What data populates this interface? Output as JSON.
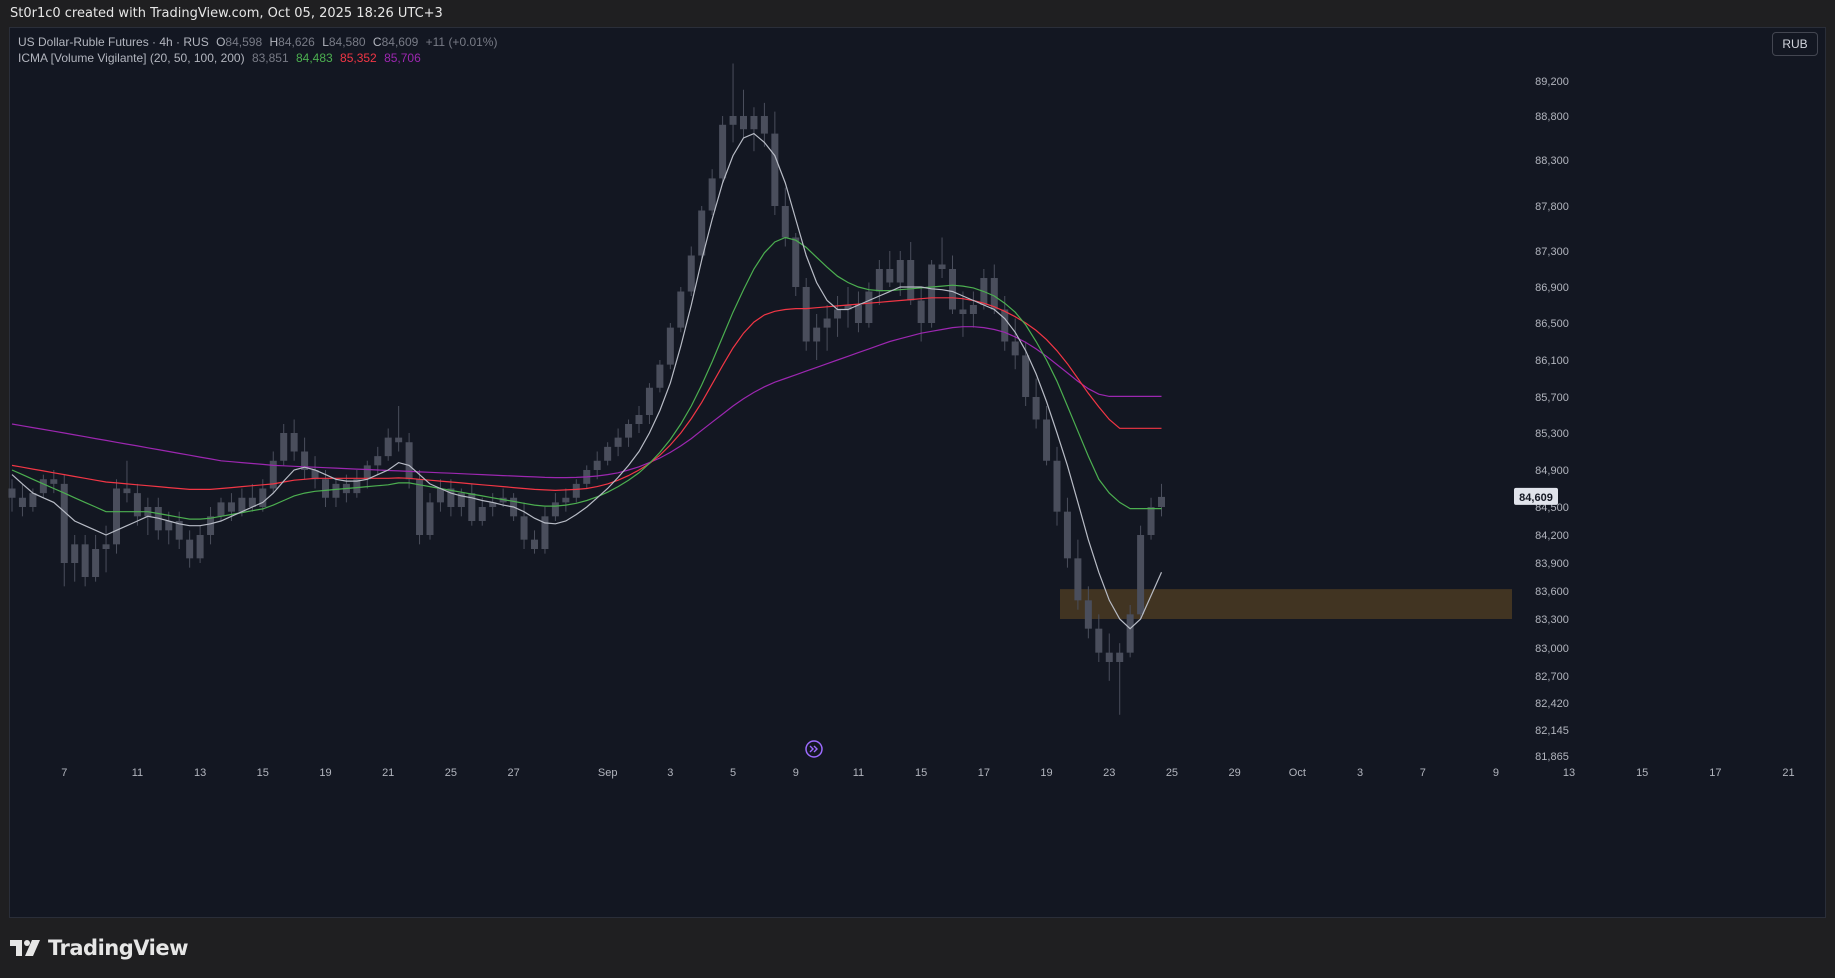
{
  "header": {
    "attribution": "St0r1c0 created with TradingView.com, Oct 05, 2025 18:26 UTC+3"
  },
  "legend": {
    "symbol_line": "US Dollar-Ruble Futures · 4h · RUS",
    "open_label": "O",
    "open": "84,598",
    "high_label": "H",
    "high": "84,626",
    "low_label": "L",
    "low": "84,580",
    "close_label": "C",
    "close": "84,609",
    "change": "+11 (+0.01%)",
    "indicator_name": "ICMA [Volume Vigilante] (20, 50, 100, 200)",
    "ma_values": [
      "83,851",
      "84,483",
      "85,352",
      "85,706"
    ]
  },
  "currency_button": "RUB",
  "footer": {
    "brand": "TradingView"
  },
  "colors": {
    "background": "#131722",
    "ma20": "#b8bcc6",
    "ma50": "#4caf50",
    "ma100": "#f23645",
    "ma200": "#9c27b0",
    "candle": "#4a4e5c",
    "zone": "#4a3a22",
    "price_tag": "#e0e3eb"
  },
  "chart_data": {
    "type": "candlestick",
    "interval": "4h",
    "y_ticks": [
      "89,200",
      "88,800",
      "88,300",
      "87,800",
      "87,300",
      "86,900",
      "86,500",
      "86,100",
      "85,700",
      "85,300",
      "84,900",
      "84,500",
      "84,200",
      "83,900",
      "83,600",
      "83,300",
      "83,000",
      "82,700",
      "82,420",
      "82,145",
      "81,865"
    ],
    "y_tick_values": [
      89200,
      88800,
      88300,
      87800,
      87300,
      86900,
      86500,
      86100,
      85700,
      85300,
      84900,
      84500,
      84200,
      83900,
      83600,
      83300,
      83000,
      82700,
      82420,
      82145,
      81865
    ],
    "x_ticks": [
      "7",
      "11",
      "13",
      "15",
      "19",
      "21",
      "25",
      "27",
      "Sep",
      "3",
      "5",
      "9",
      "11",
      "15",
      "17",
      "19",
      "23",
      "25",
      "29",
      "Oct",
      "3",
      "7",
      "9",
      "13",
      "15",
      "17",
      "21"
    ],
    "x_tick_index": [
      5,
      12,
      18,
      24,
      30,
      36,
      42,
      48,
      57,
      63,
      69,
      75,
      81,
      87,
      93,
      99,
      105,
      111,
      117,
      123,
      129,
      135,
      142,
      149,
      156,
      163,
      170
    ],
    "last_price": "84,609",
    "last_price_value": 84609,
    "demand_zone": {
      "low": 83300,
      "high": 83620
    },
    "ma_names": [
      "20",
      "50",
      "100",
      "200"
    ],
    "candles": [
      [
        84700,
        84800,
        84450,
        84600
      ],
      [
        84600,
        84750,
        84400,
        84500
      ],
      [
        84500,
        84700,
        84450,
        84650
      ],
      [
        84650,
        84850,
        84600,
        84800
      ],
      [
        84800,
        84900,
        84650,
        84750
      ],
      [
        84750,
        84850,
        83650,
        83900
      ],
      [
        83900,
        84200,
        83700,
        84100
      ],
      [
        84100,
        84200,
        83650,
        83750
      ],
      [
        83750,
        84200,
        83700,
        84050
      ],
      [
        84050,
        84300,
        83800,
        84100
      ],
      [
        84100,
        84800,
        84000,
        84700
      ],
      [
        84700,
        85000,
        84550,
        84650
      ],
      [
        84650,
        84750,
        84300,
        84400
      ],
      [
        84400,
        84600,
        84200,
        84500
      ],
      [
        84500,
        84600,
        84150,
        84250
      ],
      [
        84250,
        84450,
        84100,
        84350
      ],
      [
        84350,
        84450,
        84050,
        84150
      ],
      [
        84150,
        84250,
        83850,
        83950
      ],
      [
        83950,
        84300,
        83900,
        84200
      ],
      [
        84200,
        84500,
        84100,
        84400
      ],
      [
        84400,
        84600,
        84350,
        84550
      ],
      [
        84550,
        84650,
        84350,
        84450
      ],
      [
        84450,
        84700,
        84400,
        84600
      ],
      [
        84600,
        84750,
        84450,
        84500
      ],
      [
        84500,
        84800,
        84450,
        84700
      ],
      [
        84700,
        85100,
        84650,
        85000
      ],
      [
        85000,
        85400,
        84950,
        85300
      ],
      [
        85300,
        85450,
        85000,
        85100
      ],
      [
        85100,
        85250,
        84800,
        84900
      ],
      [
        84900,
        85050,
        84700,
        84800
      ],
      [
        84800,
        84900,
        84500,
        84600
      ],
      [
        84600,
        84800,
        84500,
        84750
      ],
      [
        84750,
        84850,
        84550,
        84650
      ],
      [
        84650,
        84900,
        84600,
        84800
      ],
      [
        84800,
        85000,
        84700,
        84950
      ],
      [
        84950,
        85150,
        84850,
        85050
      ],
      [
        85050,
        85350,
        85000,
        85250
      ],
      [
        85250,
        85600,
        85100,
        85200
      ],
      [
        85200,
        85300,
        84700,
        84800
      ],
      [
        84800,
        84900,
        84100,
        84200
      ],
      [
        84200,
        84650,
        84150,
        84550
      ],
      [
        84550,
        84800,
        84450,
        84700
      ],
      [
        84700,
        84800,
        84400,
        84500
      ],
      [
        84500,
        84700,
        84400,
        84650
      ],
      [
        84650,
        84750,
        84300,
        84350
      ],
      [
        84350,
        84600,
        84300,
        84500
      ],
      [
        84500,
        84650,
        84400,
        84550
      ],
      [
        84550,
        84700,
        84500,
        84600
      ],
      [
        84600,
        84650,
        84350,
        84400
      ],
      [
        84400,
        84550,
        84050,
        84150
      ],
      [
        84150,
        84250,
        84000,
        84050
      ],
      [
        84050,
        84500,
        84000,
        84400
      ],
      [
        84400,
        84650,
        84350,
        84550
      ],
      [
        84550,
        84700,
        84450,
        84600
      ],
      [
        84600,
        84800,
        84550,
        84750
      ],
      [
        84750,
        84950,
        84700,
        84900
      ],
      [
        84900,
        85100,
        84800,
        85000
      ],
      [
        85000,
        85200,
        84950,
        85150
      ],
      [
        85150,
        85350,
        85050,
        85250
      ],
      [
        85250,
        85450,
        85150,
        85400
      ],
      [
        85400,
        85600,
        85300,
        85500
      ],
      [
        85500,
        85850,
        85400,
        85800
      ],
      [
        85800,
        86100,
        85750,
        86050
      ],
      [
        86050,
        86500,
        86000,
        86450
      ],
      [
        86450,
        86900,
        86400,
        86850
      ],
      [
        86850,
        87350,
        86800,
        87250
      ],
      [
        87250,
        87800,
        87200,
        87750
      ],
      [
        87750,
        88200,
        87700,
        88100
      ],
      [
        88100,
        88800,
        88050,
        88700
      ],
      [
        88700,
        89400,
        88500,
        88800
      ],
      [
        88800,
        89100,
        88550,
        88650
      ],
      [
        88650,
        88900,
        88400,
        88800
      ],
      [
        88800,
        88950,
        88450,
        88600
      ],
      [
        88600,
        88850,
        87700,
        87800
      ],
      [
        87800,
        88000,
        87350,
        87450
      ],
      [
        87450,
        87500,
        86800,
        86900
      ],
      [
        86900,
        87000,
        86200,
        86300
      ],
      [
        86300,
        86600,
        86100,
        86450
      ],
      [
        86450,
        86700,
        86200,
        86550
      ],
      [
        86550,
        86800,
        86350,
        86650
      ],
      [
        86650,
        86900,
        86450,
        86700
      ],
      [
        86700,
        86850,
        86400,
        86500
      ],
      [
        86500,
        86950,
        86450,
        86850
      ],
      [
        86850,
        87200,
        86700,
        87100
      ],
      [
        87100,
        87300,
        86900,
        86950
      ],
      [
        86950,
        87300,
        86800,
        87200
      ],
      [
        87200,
        87400,
        86700,
        86750
      ],
      [
        86750,
        86900,
        86300,
        86500
      ],
      [
        86500,
        87200,
        86450,
        87150
      ],
      [
        87150,
        87450,
        87000,
        87100
      ],
      [
        87100,
        87250,
        86600,
        86650
      ],
      [
        86650,
        86850,
        86350,
        86600
      ],
      [
        86600,
        86850,
        86450,
        86700
      ],
      [
        86700,
        87100,
        86650,
        87000
      ],
      [
        87000,
        87150,
        86600,
        86650
      ],
      [
        86650,
        86800,
        86200,
        86300
      ],
      [
        86300,
        86550,
        86000,
        86150
      ],
      [
        86150,
        86300,
        85600,
        85700
      ],
      [
        85700,
        85900,
        85350,
        85450
      ],
      [
        85450,
        85600,
        84950,
        85000
      ],
      [
        85000,
        85150,
        84300,
        84450
      ],
      [
        84450,
        84600,
        83850,
        83950
      ],
      [
        83950,
        84150,
        83400,
        83500
      ],
      [
        83500,
        83650,
        83100,
        83200
      ],
      [
        83200,
        83350,
        82850,
        82950
      ],
      [
        82950,
        83150,
        82650,
        82850
      ],
      [
        82850,
        83050,
        82300,
        82950
      ],
      [
        82950,
        83450,
        82900,
        83350
      ],
      [
        83350,
        84300,
        83300,
        84200
      ],
      [
        84200,
        84600,
        84150,
        84500
      ],
      [
        84500,
        84750,
        84400,
        84609
      ]
    ],
    "ma": {
      "ma20": [
        84850,
        84750,
        84650,
        84600,
        84550,
        84450,
        84350,
        84300,
        84250,
        84200,
        84250,
        84300,
        84350,
        84400,
        84380,
        84350,
        84320,
        84300,
        84300,
        84320,
        84350,
        84400,
        84450,
        84500,
        84550,
        84650,
        84780,
        84900,
        84930,
        84900,
        84850,
        84800,
        84780,
        84780,
        84800,
        84850,
        84900,
        84980,
        84950,
        84850,
        84750,
        84700,
        84650,
        84620,
        84600,
        84570,
        84550,
        84520,
        84500,
        84450,
        84380,
        84330,
        84320,
        84350,
        84420,
        84500,
        84600,
        84700,
        84820,
        84950,
        85100,
        85300,
        85550,
        85850,
        86250,
        86700,
        87200,
        87650,
        88050,
        88350,
        88550,
        88600,
        88500,
        88350,
        88050,
        87650,
        87250,
        86950,
        86750,
        86650,
        86650,
        86700,
        86750,
        86800,
        86850,
        86900,
        86900,
        86900,
        86880,
        86870,
        86850,
        86800,
        86750,
        86700,
        86650,
        86550,
        86400,
        86200,
        85950,
        85650,
        85300,
        84950,
        84550,
        84150,
        83800,
        83500,
        83300,
        83200,
        83300,
        83550,
        83800
      ],
      "ma50": [
        84900,
        84850,
        84800,
        84750,
        84700,
        84650,
        84600,
        84550,
        84500,
        84450,
        84450,
        84450,
        84450,
        84450,
        84430,
        84410,
        84390,
        84370,
        84370,
        84380,
        84400,
        84420,
        84440,
        84460,
        84480,
        84520,
        84570,
        84620,
        84650,
        84670,
        84680,
        84690,
        84700,
        84710,
        84720,
        84730,
        84740,
        84760,
        84760,
        84740,
        84720,
        84700,
        84680,
        84660,
        84640,
        84620,
        84600,
        84580,
        84560,
        84540,
        84520,
        84510,
        84510,
        84520,
        84540,
        84570,
        84610,
        84660,
        84720,
        84790,
        84870,
        84970,
        85090,
        85230,
        85400,
        85600,
        85830,
        86080,
        86350,
        86620,
        86870,
        87100,
        87280,
        87400,
        87450,
        87420,
        87340,
        87230,
        87120,
        87020,
        86950,
        86900,
        86870,
        86860,
        86860,
        86870,
        86880,
        86890,
        86900,
        86910,
        86920,
        86910,
        86890,
        86850,
        86800,
        86720,
        86620,
        86480,
        86300,
        86100,
        85870,
        85600,
        85320,
        85050,
        84800,
        84650,
        84550,
        84483,
        84483,
        84483,
        84483
      ],
      "ma100": [
        84950,
        84930,
        84910,
        84890,
        84870,
        84850,
        84830,
        84810,
        84790,
        84770,
        84760,
        84750,
        84740,
        84730,
        84720,
        84710,
        84700,
        84690,
        84690,
        84690,
        84700,
        84710,
        84720,
        84730,
        84740,
        84750,
        84770,
        84790,
        84800,
        84810,
        84810,
        84810,
        84810,
        84810,
        84810,
        84810,
        84810,
        84815,
        84810,
        84800,
        84790,
        84780,
        84770,
        84760,
        84750,
        84740,
        84730,
        84720,
        84710,
        84700,
        84690,
        84685,
        84680,
        84685,
        84690,
        84700,
        84720,
        84750,
        84790,
        84840,
        84900,
        84970,
        85060,
        85170,
        85300,
        85460,
        85640,
        85840,
        86040,
        86230,
        86390,
        86510,
        86590,
        86630,
        86650,
        86660,
        86660,
        86670,
        86680,
        86690,
        86700,
        86710,
        86720,
        86730,
        86740,
        86750,
        86760,
        86770,
        86780,
        86780,
        86780,
        86770,
        86750,
        86720,
        86680,
        86630,
        86570,
        86500,
        86420,
        86320,
        86200,
        86060,
        85900,
        85740,
        85590,
        85450,
        85352,
        85352,
        85352,
        85352,
        85352
      ],
      "ma200": [
        85400,
        85380,
        85360,
        85340,
        85320,
        85300,
        85280,
        85260,
        85240,
        85220,
        85200,
        85180,
        85160,
        85140,
        85120,
        85100,
        85080,
        85060,
        85040,
        85020,
        85000,
        84990,
        84980,
        84970,
        84960,
        84950,
        84945,
        84940,
        84935,
        84930,
        84925,
        84920,
        84915,
        84910,
        84905,
        84900,
        84895,
        84890,
        84885,
        84880,
        84875,
        84870,
        84865,
        84860,
        84855,
        84850,
        84845,
        84840,
        84835,
        84830,
        84825,
        84820,
        84818,
        84818,
        84820,
        84825,
        84835,
        84850,
        84870,
        84900,
        84935,
        84980,
        85030,
        85090,
        85160,
        85240,
        85330,
        85420,
        85510,
        85600,
        85680,
        85750,
        85810,
        85860,
        85900,
        85940,
        85980,
        86020,
        86060,
        86100,
        86140,
        86180,
        86220,
        86260,
        86300,
        86330,
        86360,
        86390,
        86410,
        86430,
        86450,
        86460,
        86460,
        86450,
        86430,
        86400,
        86350,
        86290,
        86220,
        86140,
        86050,
        85960,
        85870,
        85790,
        85730,
        85706,
        85706,
        85706,
        85706,
        85706,
        85706
      ]
    }
  }
}
